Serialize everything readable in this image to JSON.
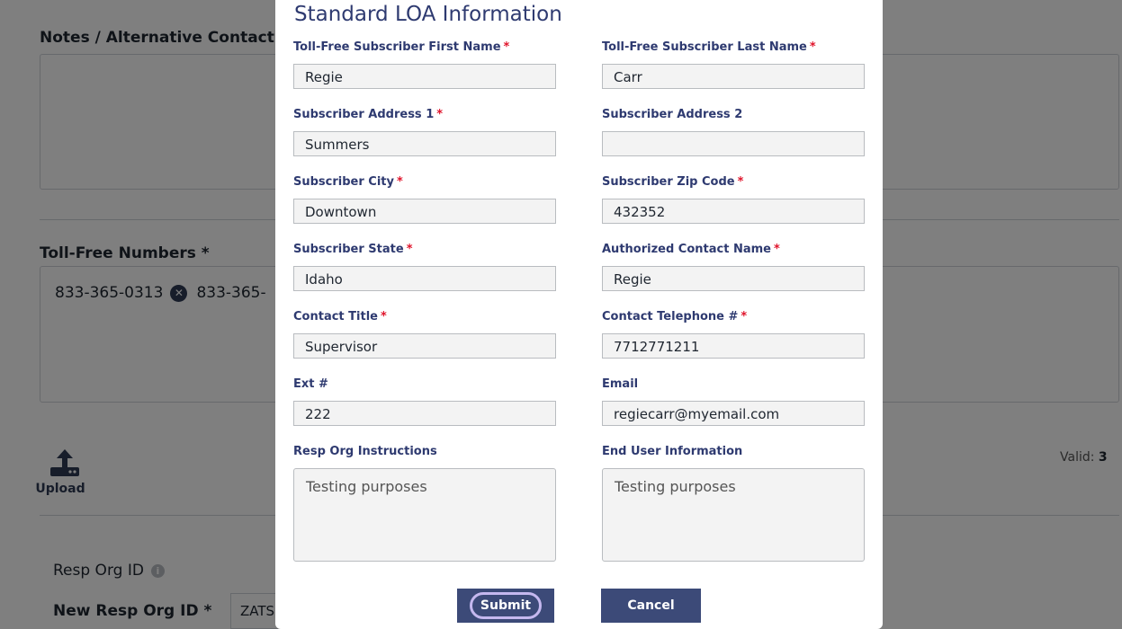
{
  "background": {
    "notes_title": "Notes / Alternative Contact In",
    "tfn_title": "Toll-Free Numbers *",
    "tfn_items": [
      "833-365-0313",
      "833-365-"
    ],
    "upload_label": "Upload",
    "valid_label": "Valid:",
    "valid_count": "3",
    "resp_org_label": "Resp Org ID",
    "new_resp_org_label": "New Resp Org ID *",
    "new_resp_org_value": "ZATS"
  },
  "modal": {
    "title": "Standard LOA Information",
    "fields": {
      "first_name": {
        "label": "Toll-Free Subscriber First Name",
        "value": "Regie"
      },
      "last_name": {
        "label": "Toll-Free Subscriber Last Name",
        "value": "Carr"
      },
      "address1": {
        "label": "Subscriber Address 1",
        "value": "Summers"
      },
      "address2": {
        "label": "Subscriber Address 2",
        "value": ""
      },
      "city": {
        "label": "Subscriber City",
        "value": "Downtown"
      },
      "zip": {
        "label": "Subscriber Zip Code",
        "value": "432352"
      },
      "state": {
        "label": "Subscriber State",
        "value": "Idaho"
      },
      "contact_name": {
        "label": "Authorized Contact Name",
        "value": "Regie"
      },
      "contact_title": {
        "label": "Contact Title",
        "value": "Supervisor"
      },
      "contact_phone": {
        "label": "Contact Telephone #",
        "value": "7712771211"
      },
      "ext": {
        "label": "Ext #",
        "value": "222"
      },
      "email": {
        "label": "Email",
        "value": "regiecarr@myemail.com"
      },
      "resp_org_instructions": {
        "label": "Resp Org Instructions",
        "value": "Testing purposes"
      },
      "end_user_info": {
        "label": "End User Information",
        "value": "Testing purposes"
      }
    },
    "required_mark": "*",
    "submit_label": "Submit",
    "cancel_label": "Cancel"
  }
}
